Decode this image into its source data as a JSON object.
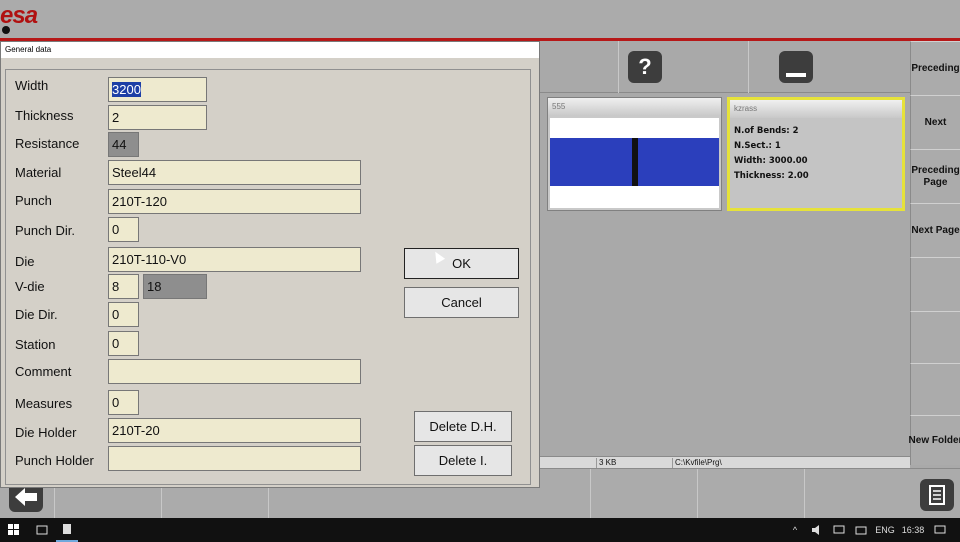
{
  "app": {
    "logo": "esa",
    "brand_color": "#b61818"
  },
  "toolbar": {
    "help_label": "?",
    "minimize_icon": "minimize-icon"
  },
  "sidenav": {
    "items": [
      {
        "label": "Preceding"
      },
      {
        "label": "Next"
      },
      {
        "label": "Preceding Page"
      },
      {
        "label": "Next Page"
      },
      {
        "label": ""
      },
      {
        "label": ""
      },
      {
        "label": ""
      },
      {
        "label": "New Folder"
      }
    ]
  },
  "cards": [
    {
      "caption": "555"
    },
    {
      "caption": "kzrass",
      "lines": [
        "N.of Bends: 2",
        "N.Sect.: 1",
        "Width: 3000.00",
        "Thickness: 2.00"
      ]
    }
  ],
  "statusbar": {
    "size": "3 KB",
    "path": "C:\\Kvfile\\Prg\\"
  },
  "dialog": {
    "title": "General data",
    "fields": {
      "width": {
        "label": "Width",
        "value": "3200"
      },
      "thickness": {
        "label": "Thickness",
        "value": "2"
      },
      "resistance": {
        "label": "Resistance",
        "value": "44"
      },
      "material": {
        "label": "Material",
        "value": "Steel44"
      },
      "punch": {
        "label": "Punch",
        "value": "210T-120"
      },
      "punch_dir": {
        "label": "Punch Dir.",
        "value": "0"
      },
      "die": {
        "label": "Die",
        "value": "210T-110-V0"
      },
      "v_die": {
        "label": "V-die",
        "value": "8",
        "value2": "18"
      },
      "die_dir": {
        "label": "Die Dir.",
        "value": "0"
      },
      "station": {
        "label": "Station",
        "value": "0"
      },
      "comment": {
        "label": "Comment",
        "value": ""
      },
      "measures": {
        "label": "Measures",
        "value": "0"
      },
      "die_holder": {
        "label": "Die Holder",
        "value": "210T-20"
      },
      "punch_holder": {
        "label": "Punch Holder",
        "value": ""
      }
    },
    "buttons": {
      "ok": "OK",
      "cancel": "Cancel",
      "delete_dh": "Delete D.H.",
      "delete_i": "Delete I."
    }
  },
  "taskbar": {
    "language": "ENG",
    "time": "16:38"
  }
}
